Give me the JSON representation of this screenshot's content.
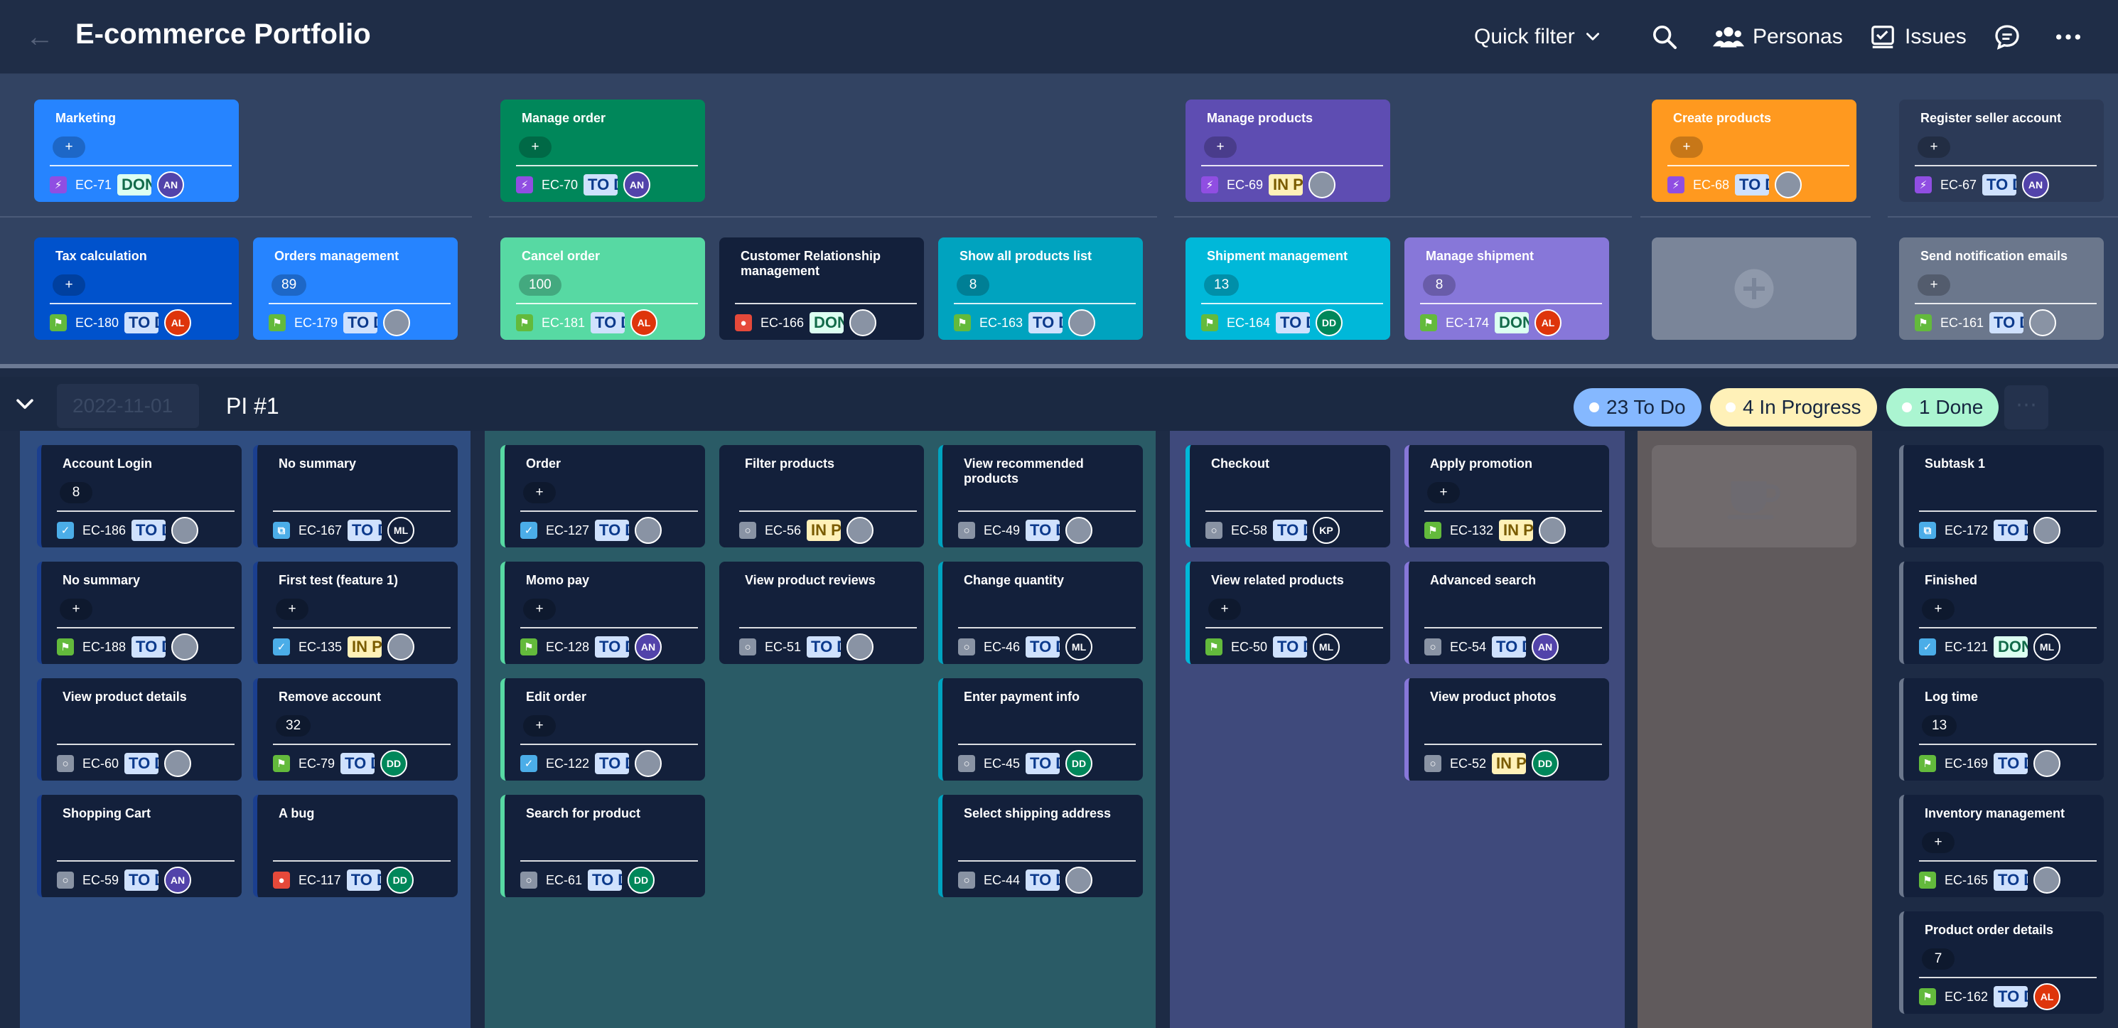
{
  "header": {
    "title": "E-commerce Portfolio",
    "quick_filter": "Quick filter",
    "personas": "Personas",
    "issues": "Issues"
  },
  "pi": {
    "date_placeholder": "2022-11-01",
    "name": "PI #1",
    "todo": "23 To Do",
    "in_progress": "4 In Progress",
    "done": "1 Done"
  },
  "colors": {
    "lane_blue": "#2f4d80",
    "lane_teal": "#2a5b66",
    "lane_purple": "#3f4a7c",
    "lane_gray": "#605a5c",
    "status_todo_bg": "#cfe1fd",
    "status_todo_fg": "#0c3a8c",
    "status_done_bg": "#dcfff1",
    "status_done_fg": "#126b4a",
    "status_inprog_bg": "#fff1b8",
    "status_inprog_fg": "#7a5c00"
  },
  "epics": [
    {
      "title": "Marketing",
      "pill": "+",
      "key": "EC-71",
      "status": "DONE",
      "avatar": "AN",
      "color": "#2684ff"
    },
    {
      "title": "Manage order",
      "pill": "+",
      "key": "EC-70",
      "status": "TO DO",
      "avatar": "AN",
      "color": "#00875a"
    },
    {
      "title": "Manage products",
      "pill": "+",
      "key": "EC-69",
      "status": "IN PROGRESS",
      "avatar": "",
      "color": "#5e4db2"
    },
    {
      "title": "Create products",
      "pill": "+",
      "key": "EC-68",
      "status": "TO DO",
      "avatar": "",
      "color": "#ff991f"
    },
    {
      "title": "Register seller account",
      "pill": "+",
      "key": "EC-67",
      "status": "TO DO",
      "avatar": "AN",
      "color": "#2c3a57"
    }
  ],
  "features": [
    {
      "title": "Tax calculation",
      "pill": "+",
      "key": "EC-180",
      "status": "TO DO",
      "avatar": "AL",
      "color": "#0052cc"
    },
    {
      "title": "Orders management",
      "pill": "89",
      "key": "EC-179",
      "status": "TO DO",
      "avatar": "",
      "color": "#2684ff"
    },
    {
      "title": "Cancel order",
      "pill": "100",
      "key": "EC-181",
      "status": "TO DO",
      "avatar": "AL",
      "color": "#57d9a3"
    },
    {
      "title": "Customer Relationship management",
      "pill": "",
      "key": "EC-166",
      "status": "DONE",
      "avatar": "",
      "color": "#13203b"
    },
    {
      "title": "Show all products list",
      "pill": "8",
      "key": "EC-163",
      "status": "TO DO",
      "avatar": "",
      "color": "#00a3bf"
    },
    {
      "title": "Shipment management",
      "pill": "13",
      "key": "EC-164",
      "status": "TO DO",
      "avatar": "DD",
      "color": "#00b8d9"
    },
    {
      "title": "Manage shipment",
      "pill": "8",
      "key": "EC-174",
      "status": "DONE",
      "avatar": "AL",
      "color": "#8777d9"
    },
    {
      "title": "Send notification emails",
      "pill": "+",
      "key": "EC-161",
      "status": "TO DO",
      "avatar": "",
      "color": "#6b778c"
    }
  ],
  "stories": [
    {
      "title": "Account Login",
      "pill": "8",
      "key": "EC-186",
      "status": "TO DO",
      "avatar": "",
      "type": "task"
    },
    {
      "title": "No summary",
      "pill": "",
      "key": "EC-167",
      "status": "TO DO",
      "avatar": "ML",
      "type": "subtask"
    },
    {
      "title": "No summary",
      "pill": "+",
      "key": "EC-188",
      "status": "TO DO",
      "avatar": "",
      "type": "story"
    },
    {
      "title": "First test (feature 1)",
      "pill": "+",
      "key": "EC-135",
      "status": "IN PROGRESS",
      "avatar": "",
      "type": "task"
    },
    {
      "title": "View product details",
      "pill": "",
      "key": "EC-60",
      "status": "TO DO",
      "avatar": "",
      "type": "other"
    },
    {
      "title": "Remove account",
      "pill": "32",
      "key": "EC-79",
      "status": "TO DO",
      "avatar": "DD",
      "type": "story"
    },
    {
      "title": "Shopping Cart",
      "pill": "",
      "key": "EC-59",
      "status": "TO DO",
      "avatar": "AN",
      "type": "other"
    },
    {
      "title": "A bug",
      "pill": "",
      "key": "EC-117",
      "status": "TO DO",
      "avatar": "DD",
      "type": "bug"
    },
    {
      "title": "Order",
      "pill": "+",
      "key": "EC-127",
      "status": "TO DO",
      "avatar": "",
      "type": "task"
    },
    {
      "title": "Filter products",
      "pill": "",
      "key": "EC-56",
      "status": "IN PROGRESS",
      "avatar": "",
      "type": "other"
    },
    {
      "title": "View recommended products",
      "pill": "",
      "key": "EC-49",
      "status": "TO DO",
      "avatar": "",
      "type": "other"
    },
    {
      "title": "Momo pay",
      "pill": "+",
      "key": "EC-128",
      "status": "TO DO",
      "avatar": "AN",
      "type": "story"
    },
    {
      "title": "View product reviews",
      "pill": "",
      "key": "EC-51",
      "status": "TO DO",
      "avatar": "",
      "type": "other"
    },
    {
      "title": "Change quantity",
      "pill": "",
      "key": "EC-46",
      "status": "TO DO",
      "avatar": "ML",
      "type": "other"
    },
    {
      "title": "Edit order",
      "pill": "+",
      "key": "EC-122",
      "status": "TO DO",
      "avatar": "",
      "type": "task"
    },
    {
      "title": "Enter payment info",
      "pill": "",
      "key": "EC-45",
      "status": "TO DO",
      "avatar": "DD",
      "type": "other"
    },
    {
      "title": "Search for product",
      "pill": "",
      "key": "EC-61",
      "status": "TO DO",
      "avatar": "DD",
      "type": "other"
    },
    {
      "title": "Select shipping address",
      "pill": "",
      "key": "EC-44",
      "status": "TO DO",
      "avatar": "",
      "type": "other"
    },
    {
      "title": "Checkout",
      "pill": "",
      "key": "EC-58",
      "status": "TO DO",
      "avatar": "KP",
      "type": "other"
    },
    {
      "title": "Apply promotion",
      "pill": "+",
      "key": "EC-132",
      "status": "IN PROGRESS",
      "avatar": "",
      "type": "story"
    },
    {
      "title": "View related products",
      "pill": "+",
      "key": "EC-50",
      "status": "TO DO",
      "avatar": "ML",
      "type": "story"
    },
    {
      "title": "Advanced search",
      "pill": "",
      "key": "EC-54",
      "status": "TO DO",
      "avatar": "AN",
      "type": "other"
    },
    {
      "title": "View product photos",
      "pill": "",
      "key": "EC-52",
      "status": "IN PROGRESS",
      "avatar": "DD",
      "type": "other"
    },
    {
      "title": "Subtask 1",
      "pill": "",
      "key": "EC-172",
      "status": "TO DO",
      "avatar": "",
      "type": "subtask"
    },
    {
      "title": "Finished",
      "pill": "+",
      "key": "EC-121",
      "status": "DONE",
      "avatar": "ML",
      "type": "task"
    },
    {
      "title": "Log time",
      "pill": "13",
      "key": "EC-169",
      "status": "TO DO",
      "avatar": "",
      "type": "story"
    },
    {
      "title": "Inventory management",
      "pill": "+",
      "key": "EC-165",
      "status": "TO DO",
      "avatar": "",
      "type": "story"
    },
    {
      "title": "Product order details",
      "pill": "7",
      "key": "EC-162",
      "status": "TO DO",
      "avatar": "AL",
      "type": "story"
    }
  ]
}
